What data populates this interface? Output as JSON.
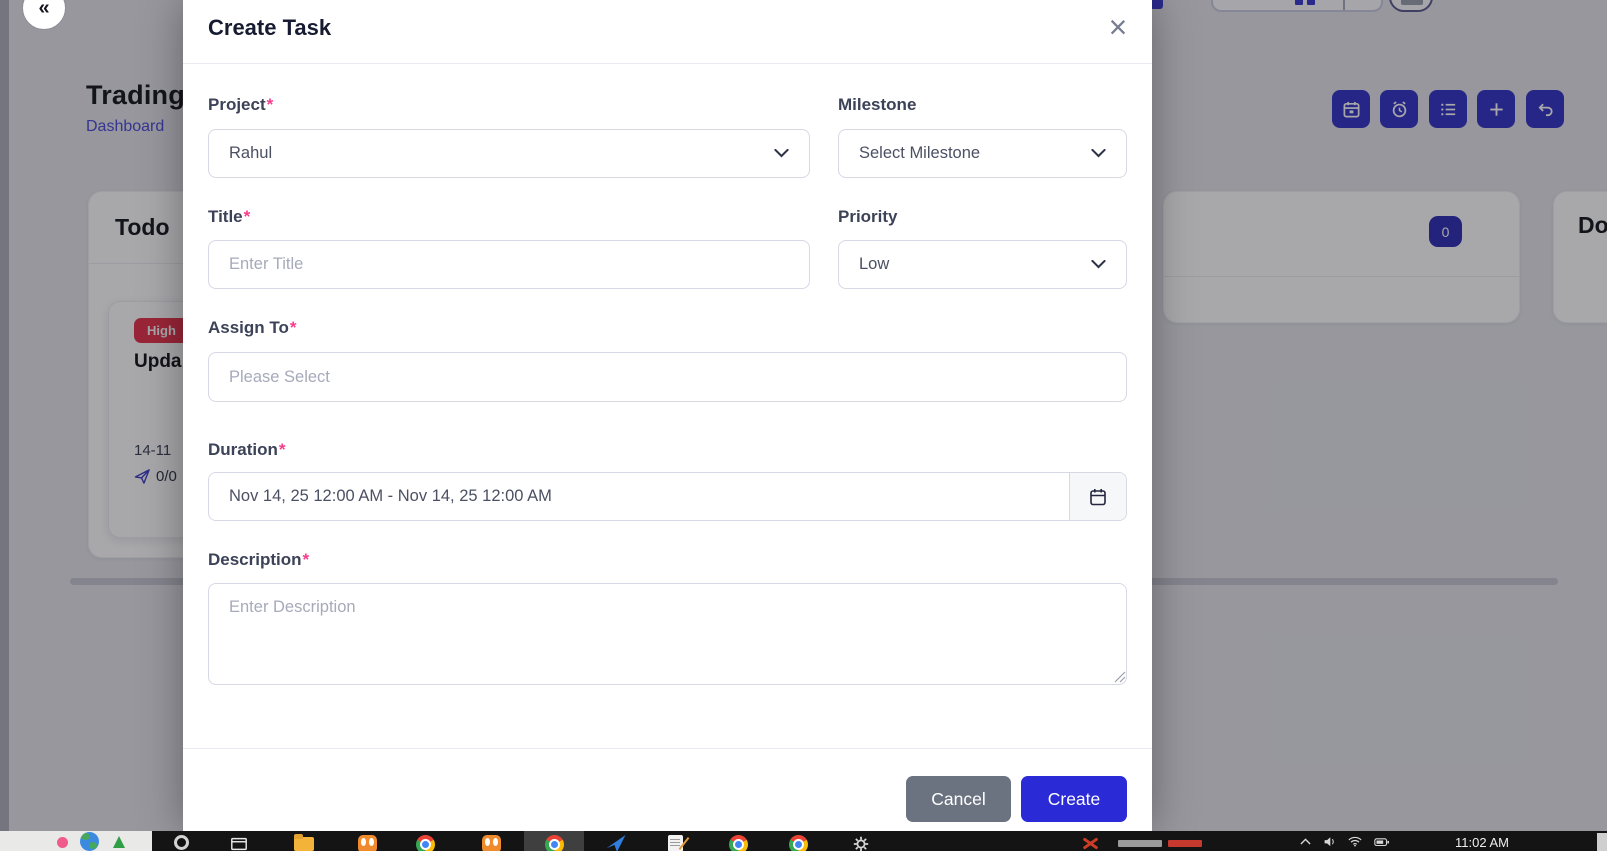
{
  "page": {
    "collapse_glyph": "«",
    "title": "Trading",
    "breadcrumb": "Dashboard",
    "toolbar_icons": [
      "calendar-icon",
      "alarm-clock-icon",
      "list-icon",
      "plus-icon",
      "undo-icon"
    ],
    "board": {
      "todo_column": {
        "title": "Todo"
      },
      "middle_column": {
        "count": "0"
      },
      "done_column": {
        "title": "Do"
      },
      "task_card": {
        "priority_badge": "High",
        "title": "Upda",
        "date": "14-11",
        "counter": "0/0",
        "counter_icon": "send-icon"
      }
    }
  },
  "modal": {
    "title": "Create Task",
    "close_glyph": "×",
    "required_mark": "*",
    "project": {
      "label": "Project",
      "value": "Rahul"
    },
    "milestone": {
      "label": "Milestone",
      "value": "Select Milestone"
    },
    "task_title": {
      "label": "Title",
      "placeholder": "Enter Title"
    },
    "priority": {
      "label": "Priority",
      "value": "Low"
    },
    "assign_to": {
      "label": "Assign To",
      "placeholder": "Please Select"
    },
    "duration": {
      "label": "Duration",
      "value": "Nov 14, 25 12:00 AM - Nov 14, 25 12:00 AM",
      "addon_icon": "calendar-icon"
    },
    "description": {
      "label": "Description",
      "placeholder": "Enter Description"
    },
    "cancel_label": "Cancel",
    "create_label": "Create"
  },
  "taskbar": {
    "time": "11:02 AM"
  },
  "colors": {
    "create_blue": "#2a2ad6",
    "toolbar_blue": "#3434c6",
    "priority_red": "#e8354b",
    "cancel_gray": "#6b7280",
    "required_pink": "#f53d8c",
    "link_indigo": "#4c4cd8",
    "overlay": "rgba(15,15,22,0.36)"
  }
}
